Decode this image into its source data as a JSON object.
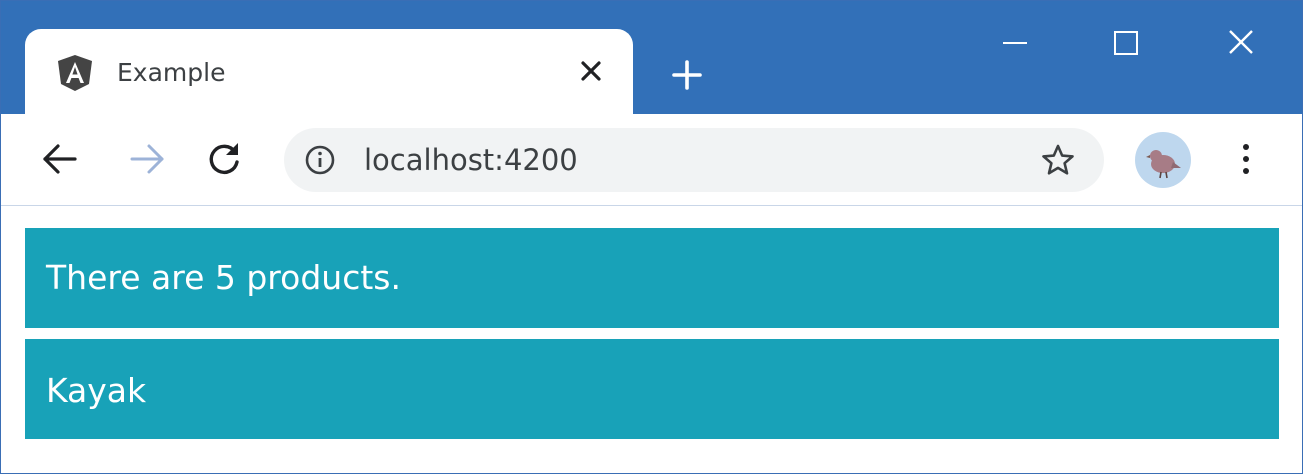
{
  "browser": {
    "tab": {
      "title": "Example",
      "favicon": "angular-logo-icon"
    },
    "new_tab_icon": "plus-icon",
    "window_controls": [
      "minimize-icon",
      "maximize-icon",
      "close-icon"
    ],
    "toolbar": {
      "back_icon": "back-arrow-icon",
      "forward_icon": "forward-arrow-icon",
      "reload_icon": "reload-icon",
      "site_info_icon": "info-icon",
      "url": "localhost:4200",
      "bookmark_icon": "star-icon",
      "profile_icon": "bird-avatar-icon",
      "menu_icon": "more-vertical-icon"
    },
    "colors": {
      "titlebar": "#3270b8",
      "panel": "#18a2b8",
      "omnibox": "#f1f3f4"
    }
  },
  "page": {
    "summary": "There are 5 products.",
    "product": "Kayak"
  }
}
